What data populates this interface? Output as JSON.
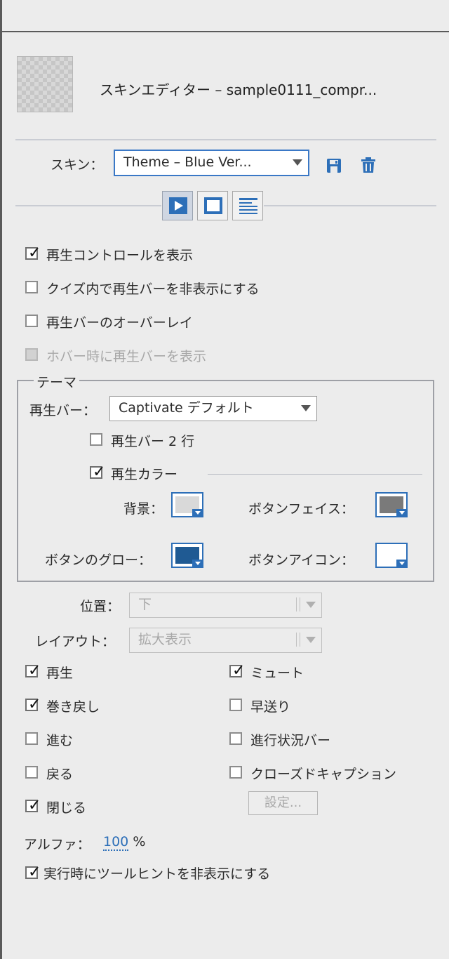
{
  "editor": {
    "title": "スキンエディター – sample0111_compr..."
  },
  "skin": {
    "label": "スキン：",
    "selected": "Theme – Blue Ver...",
    "save_icon": "save-icon",
    "delete_icon": "trash-icon"
  },
  "tabs": [
    {
      "icon": "playbar-tab-icon",
      "active": true
    },
    {
      "icon": "borders-tab-icon",
      "active": false
    },
    {
      "icon": "toc-tab-icon",
      "active": false
    }
  ],
  "options": {
    "show_playback": "再生コントロールを表示",
    "hide_in_quiz": "クイズ内で再生バーを非表示にする",
    "overlay": "再生バーのオーバーレイ",
    "show_on_hover": "ホバー時に再生バーを表示"
  },
  "theme": {
    "legend": "テーマ",
    "playbar_label": "再生バー：",
    "playbar_selected": "Captivate デフォルト",
    "two_rows": "再生バー 2 行",
    "playbar_color": "再生カラー",
    "bg_label": "背景：",
    "face_label": "ボタンフェイス：",
    "glow_label": "ボタンのグロー：",
    "icon_label": "ボタンアイコン：",
    "colors": {
      "background": "#d9d9d9",
      "button_face": "#7a7a7a",
      "button_glow": "#1f5a93",
      "button_icon": "#ffffff"
    }
  },
  "position": {
    "label": "位置：",
    "value": "下"
  },
  "layout": {
    "label": "レイアウト：",
    "value": "拡大表示"
  },
  "controls": {
    "play": "再生",
    "rewind": "巻き戻し",
    "forward": "進む",
    "back": "戻る",
    "close": "閉じる",
    "mute": "ミュート",
    "fastforward": "早送り",
    "progress": "進行状況バー",
    "cc": "クローズドキャプション",
    "settings": "設定..."
  },
  "alpha": {
    "label": "アルファ：",
    "value": "100",
    "unit": "%"
  },
  "tooltip": {
    "label": "実行時にツールヒントを非表示にする"
  }
}
